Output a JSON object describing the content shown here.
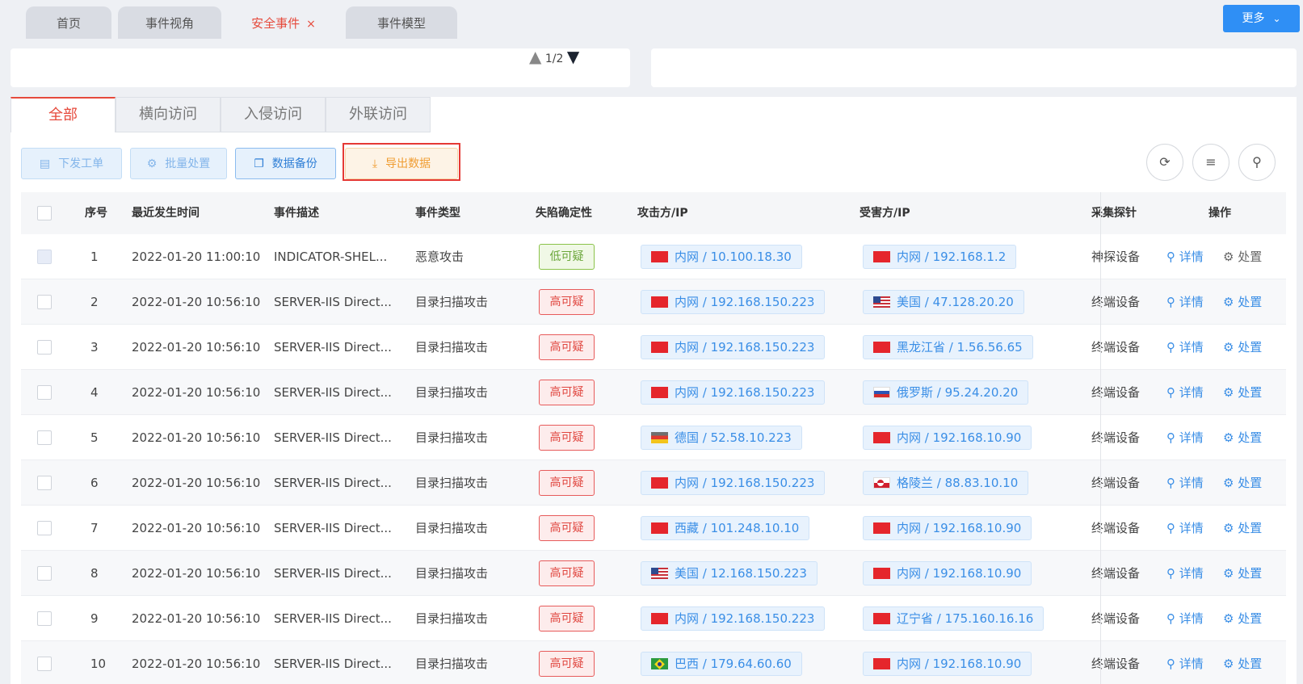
{
  "top_tabs": [
    {
      "label": "首页"
    },
    {
      "label": "事件视角"
    },
    {
      "label": "安全事件",
      "close": "×"
    },
    {
      "label": "事件模型"
    }
  ],
  "more_button": {
    "label": "更多",
    "icon": "chevron-down-icon"
  },
  "pager": {
    "text": "1/2"
  },
  "sub_tabs": [
    "全部",
    "横向访问",
    "入侵访问",
    "外联访问"
  ],
  "toolbar": {
    "dispatch": "下发工单",
    "batch": "批量处置",
    "backup": "数据备份",
    "export": "导出数据"
  },
  "table": {
    "headers": [
      "序号",
      "最近发生时间",
      "事件描述",
      "事件类型",
      "失陷确定性",
      "攻击方/IP",
      "受害方/IP",
      "采集探针",
      "操作"
    ],
    "detail_label": "详情",
    "handle_label": "处置",
    "rows": [
      {
        "no": "1",
        "time": "2022-01-20 11:00:10",
        "desc": "INDICATOR-SHEL...",
        "type": "恶意攻击",
        "certainty": "低可疑",
        "level": "low",
        "attacker": "内网 / 10.100.18.30",
        "attacker_flag": "cn",
        "victim": "内网 / 192.168.1.2",
        "victim_flag": "cn",
        "probe": "神探设备"
      },
      {
        "no": "2",
        "time": "2022-01-20 10:56:10",
        "desc": "SERVER-IIS Direct...",
        "type": "目录扫描攻击",
        "certainty": "高可疑",
        "level": "high",
        "attacker": "内网 / 192.168.150.223",
        "attacker_flag": "cn",
        "victim": "美国 / 47.128.20.20",
        "victim_flag": "us",
        "probe": "终端设备"
      },
      {
        "no": "3",
        "time": "2022-01-20 10:56:10",
        "desc": "SERVER-IIS Direct...",
        "type": "目录扫描攻击",
        "certainty": "高可疑",
        "level": "high",
        "attacker": "内网 / 192.168.150.223",
        "attacker_flag": "cn",
        "victim": "黑龙江省 / 1.56.56.65",
        "victim_flag": "cn",
        "probe": "终端设备"
      },
      {
        "no": "4",
        "time": "2022-01-20 10:56:10",
        "desc": "SERVER-IIS Direct...",
        "type": "目录扫描攻击",
        "certainty": "高可疑",
        "level": "high",
        "attacker": "内网 / 192.168.150.223",
        "attacker_flag": "cn",
        "victim": "俄罗斯 / 95.24.20.20",
        "victim_flag": "ru",
        "probe": "终端设备"
      },
      {
        "no": "5",
        "time": "2022-01-20 10:56:10",
        "desc": "SERVER-IIS Direct...",
        "type": "目录扫描攻击",
        "certainty": "高可疑",
        "level": "high",
        "attacker": "德国 / 52.58.10.223",
        "attacker_flag": "de",
        "victim": "内网 / 192.168.10.90",
        "victim_flag": "cn",
        "probe": "终端设备"
      },
      {
        "no": "6",
        "time": "2022-01-20 10:56:10",
        "desc": "SERVER-IIS Direct...",
        "type": "目录扫描攻击",
        "certainty": "高可疑",
        "level": "high",
        "attacker": "内网 / 192.168.150.223",
        "attacker_flag": "cn",
        "victim": "格陵兰 / 88.83.10.10",
        "victim_flag": "gl",
        "probe": "终端设备"
      },
      {
        "no": "7",
        "time": "2022-01-20 10:56:10",
        "desc": "SERVER-IIS Direct...",
        "type": "目录扫描攻击",
        "certainty": "高可疑",
        "level": "high",
        "attacker": "西藏 / 101.248.10.10",
        "attacker_flag": "cn",
        "victim": "内网 / 192.168.10.90",
        "victim_flag": "cn",
        "probe": "终端设备"
      },
      {
        "no": "8",
        "time": "2022-01-20 10:56:10",
        "desc": "SERVER-IIS Direct...",
        "type": "目录扫描攻击",
        "certainty": "高可疑",
        "level": "high",
        "attacker": "美国 / 12.168.150.223",
        "attacker_flag": "us",
        "victim": "内网 / 192.168.10.90",
        "victim_flag": "cn",
        "probe": "终端设备"
      },
      {
        "no": "9",
        "time": "2022-01-20 10:56:10",
        "desc": "SERVER-IIS Direct...",
        "type": "目录扫描攻击",
        "certainty": "高可疑",
        "level": "high",
        "attacker": "内网 / 192.168.150.223",
        "attacker_flag": "cn",
        "victim": "辽宁省 / 175.160.16.16",
        "victim_flag": "cn",
        "probe": "终端设备"
      },
      {
        "no": "10",
        "time": "2022-01-20 10:56:10",
        "desc": "SERVER-IIS Direct...",
        "type": "目录扫描攻击",
        "certainty": "高可疑",
        "level": "high",
        "attacker": "巴西 / 179.64.60.60",
        "attacker_flag": "br",
        "victim": "内网 / 192.168.10.90",
        "victim_flag": "cn",
        "probe": "终端设备"
      }
    ]
  },
  "colors": {
    "accent": "#e64a3c",
    "primary": "#2f8ff5",
    "link": "#3a8ee6",
    "highlight_box": "#e53935"
  }
}
